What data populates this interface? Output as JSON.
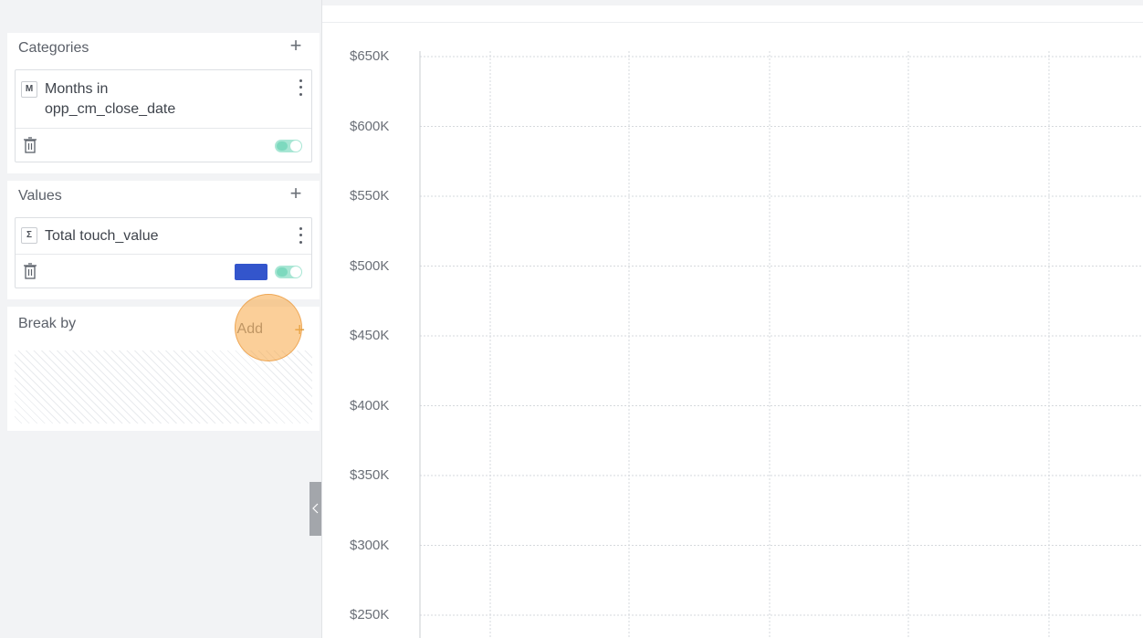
{
  "left_panel": {
    "categories": {
      "title": "Categories",
      "add_icon": "plus-icon",
      "field": {
        "badge": "M",
        "name_line1": "Months in",
        "name_line2": "opp_cm_close_date",
        "toggle_on": true
      }
    },
    "values": {
      "title": "Values",
      "add_icon": "plus-icon",
      "field": {
        "badge": "Σ",
        "name": "Total touch_value",
        "series_color": "#3355cc",
        "toggle_on": true
      }
    },
    "break_by": {
      "title": "Break by",
      "add_label": "Add",
      "add_icon": "plus-icon"
    }
  },
  "chart_data": {
    "type": "bar",
    "title": "",
    "xlabel": "",
    "ylabel": "",
    "y_ticks": [
      "$650K",
      "$600K",
      "$550K",
      "$500K",
      "$450K",
      "$400K",
      "$350K",
      "$300K",
      "$250K"
    ],
    "ylim": [
      250000,
      650000
    ],
    "grid": true,
    "series": [],
    "categories": []
  },
  "colors": {
    "accent_toggle": "#7dd9be",
    "series_color": "#3355cc",
    "click_marker": "#f7a846"
  }
}
